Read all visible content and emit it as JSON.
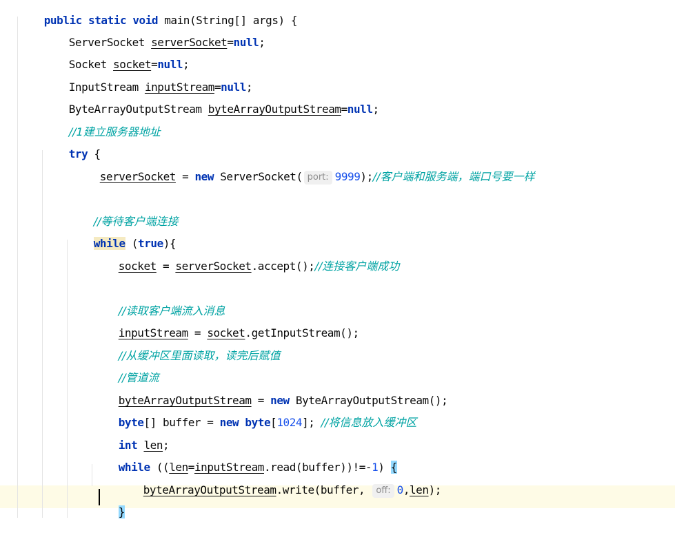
{
  "code": {
    "l1": {
      "public": "public",
      "static": "static",
      "void": "void",
      "rest": "main(String[] args) {"
    },
    "l2": {
      "type": "ServerSocket",
      "var": "serverSocket",
      "eq": "=",
      "null": "null",
      "end": ";"
    },
    "l3": {
      "type": "Socket",
      "var": "socket",
      "eq": "=",
      "null": "null",
      "end": ";"
    },
    "l4": {
      "type": "InputStream",
      "var": "inputStream",
      "eq": "=",
      "null": "null",
      "end": ";"
    },
    "l5": {
      "type": "ByteArrayOutputStream",
      "var": "byteArrayOutputStream",
      "eq": "=",
      "null": "null",
      "end": ";"
    },
    "l6": {
      "comment": "//1建立服务器地址"
    },
    "l7": {
      "try": "try",
      "rest": " {"
    },
    "l8": {
      "var": "serverSocket",
      "mid": " = ",
      "new": "new",
      "call": " ServerSocket(",
      "hint": "port:",
      "num": "9999",
      "end": ");",
      "comment": "//客户端和服务端，端口号要一样"
    },
    "l9": {
      "comment": "//等待客户端连接"
    },
    "l10": {
      "while": "while",
      "open": " (",
      "true": "true",
      "close": "){"
    },
    "l11": {
      "var": "socket",
      "mid": " = ",
      "var2": "serverSocket",
      "call": ".accept();",
      "comment": "//连接客户端成功"
    },
    "l12": {
      "comment": "//读取客户端流入消息"
    },
    "l13": {
      "var": "inputStream",
      "mid": " = ",
      "var2": "socket",
      "call": ".getInputStream();"
    },
    "l14": {
      "comment": "//从缓冲区里面读取，读完后赋值"
    },
    "l15": {
      "comment": "//管道流"
    },
    "l16": {
      "var": "byteArrayOutputStream",
      "mid": " = ",
      "new": "new",
      "call": " ByteArrayOutputStream();"
    },
    "l17": {
      "byte": "byte",
      "arr": "[] buffer = ",
      "new": "new",
      "sp": " ",
      "byte2": "byte",
      "open": "[",
      "num": "1024",
      "close": "]; ",
      "comment": "//将信息放入缓冲区"
    },
    "l18": {
      "int": "int",
      "sp": " ",
      "var": "len",
      "end": ";"
    },
    "l19": {
      "while": "while",
      "open": " ((",
      "var": "len",
      "eq": "=",
      "var2": "inputStream",
      "call": ".read(buffer))!=-",
      "num": "1",
      "close": ") ",
      "brace": "{"
    },
    "l20": {
      "var": "byteArrayOutputStream",
      "call": ".write(buffer, ",
      "hint": "off:",
      "num": "0",
      "comma": ",",
      "var2": "len",
      "end": ");"
    },
    "l21": {
      "brace": "}"
    }
  }
}
